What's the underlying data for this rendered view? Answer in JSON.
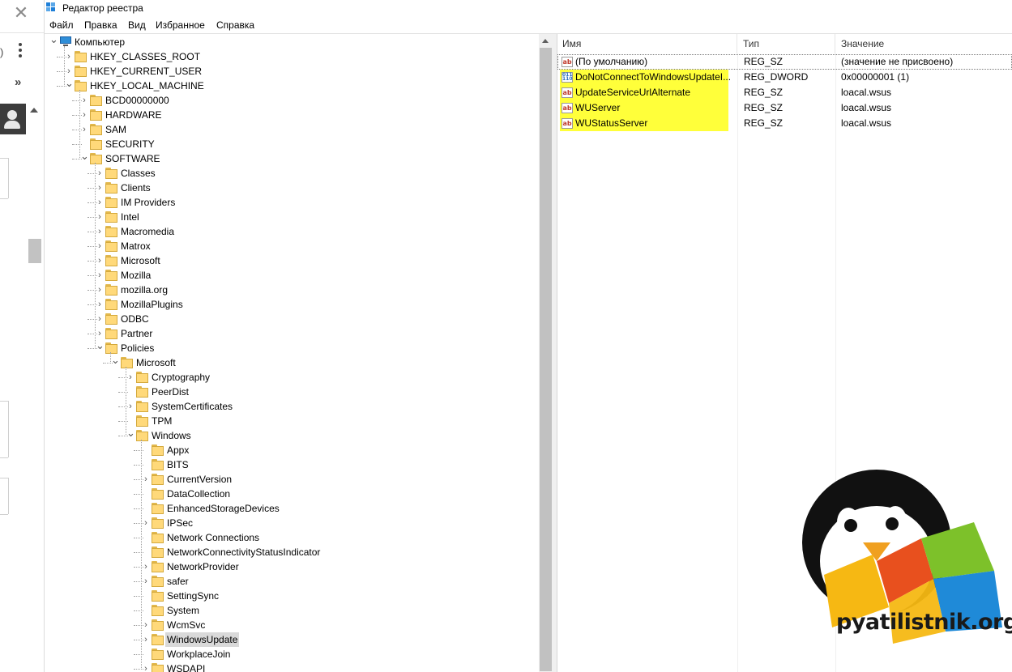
{
  "window": {
    "title": "Редактор реестра"
  },
  "menu": [
    "Файл",
    "Правка",
    "Вид",
    "Избранное",
    "Справка"
  ],
  "tree": [
    {
      "label": "Компьютер",
      "level": 0,
      "expander": "down",
      "icon": "computer-icon"
    },
    {
      "label": "HKEY_CLASSES_ROOT",
      "level": 1,
      "expander": "right"
    },
    {
      "label": "HKEY_CURRENT_USER",
      "level": 1,
      "expander": "right"
    },
    {
      "label": "HKEY_LOCAL_MACHINE",
      "level": 1,
      "expander": "down"
    },
    {
      "label": "BCD00000000",
      "level": 2,
      "expander": "right"
    },
    {
      "label": "HARDWARE",
      "level": 2,
      "expander": "right"
    },
    {
      "label": "SAM",
      "level": 2,
      "expander": "right"
    },
    {
      "label": "SECURITY",
      "level": 2,
      "expander": "none"
    },
    {
      "label": "SOFTWARE",
      "level": 2,
      "expander": "down"
    },
    {
      "label": "Classes",
      "level": 3,
      "expander": "right"
    },
    {
      "label": "Clients",
      "level": 3,
      "expander": "right"
    },
    {
      "label": "IM Providers",
      "level": 3,
      "expander": "right"
    },
    {
      "label": "Intel",
      "level": 3,
      "expander": "right"
    },
    {
      "label": "Macromedia",
      "level": 3,
      "expander": "right"
    },
    {
      "label": "Matrox",
      "level": 3,
      "expander": "right"
    },
    {
      "label": "Microsoft",
      "level": 3,
      "expander": "right"
    },
    {
      "label": "Mozilla",
      "level": 3,
      "expander": "right"
    },
    {
      "label": "mozilla.org",
      "level": 3,
      "expander": "right"
    },
    {
      "label": "MozillaPlugins",
      "level": 3,
      "expander": "right"
    },
    {
      "label": "ODBC",
      "level": 3,
      "expander": "right"
    },
    {
      "label": "Partner",
      "level": 3,
      "expander": "right"
    },
    {
      "label": "Policies",
      "level": 3,
      "expander": "down"
    },
    {
      "label": "Microsoft",
      "level": 4,
      "expander": "down"
    },
    {
      "label": "Cryptography",
      "level": 5,
      "expander": "right"
    },
    {
      "label": "PeerDist",
      "level": 5,
      "expander": "none"
    },
    {
      "label": "SystemCertificates",
      "level": 5,
      "expander": "right"
    },
    {
      "label": "TPM",
      "level": 5,
      "expander": "none"
    },
    {
      "label": "Windows",
      "level": 5,
      "expander": "down"
    },
    {
      "label": "Appx",
      "level": 6,
      "expander": "none"
    },
    {
      "label": "BITS",
      "level": 6,
      "expander": "none"
    },
    {
      "label": "CurrentVersion",
      "level": 6,
      "expander": "right"
    },
    {
      "label": "DataCollection",
      "level": 6,
      "expander": "none"
    },
    {
      "label": "EnhancedStorageDevices",
      "level": 6,
      "expander": "none"
    },
    {
      "label": "IPSec",
      "level": 6,
      "expander": "right"
    },
    {
      "label": "Network Connections",
      "level": 6,
      "expander": "none"
    },
    {
      "label": "NetworkConnectivityStatusIndicator",
      "level": 6,
      "expander": "none"
    },
    {
      "label": "NetworkProvider",
      "level": 6,
      "expander": "right"
    },
    {
      "label": "safer",
      "level": 6,
      "expander": "right"
    },
    {
      "label": "SettingSync",
      "level": 6,
      "expander": "none"
    },
    {
      "label": "System",
      "level": 6,
      "expander": "none"
    },
    {
      "label": "WcmSvc",
      "level": 6,
      "expander": "right"
    },
    {
      "label": "WindowsUpdate",
      "level": 6,
      "expander": "right",
      "selected": true
    },
    {
      "label": "WorkplaceJoin",
      "level": 6,
      "expander": "none"
    },
    {
      "label": "WSDAPI",
      "level": 6,
      "expander": "right"
    }
  ],
  "list": {
    "columns": [
      "Имя",
      "Тип",
      "Значение"
    ],
    "rows": [
      {
        "name": "(По умолчанию)",
        "type": "REG_SZ",
        "value": "(значение не присвоено)",
        "icon": "string-value-icon",
        "highlighted": false
      },
      {
        "name": "DoNotConnectToWindowsUpdateI...",
        "type": "REG_DWORD",
        "value": "0x00000001 (1)",
        "icon": "dword-value-icon",
        "highlighted": true
      },
      {
        "name": "UpdateServiceUrlAlternate",
        "type": "REG_SZ",
        "value": "loacal.wsus",
        "icon": "string-value-icon",
        "highlighted": true
      },
      {
        "name": "WUServer",
        "type": "REG_SZ",
        "value": "loacal.wsus",
        "icon": "string-value-icon",
        "highlighted": true
      },
      {
        "name": "WUStatusServer",
        "type": "REG_SZ",
        "value": "loacal.wsus",
        "icon": "string-value-icon",
        "highlighted": true
      }
    ]
  },
  "watermark": {
    "text": "pyatilistnik.org"
  },
  "colors": {
    "highlight": "#ffff3a",
    "selection": "#d9d9d9",
    "folder": "#ffd97a"
  }
}
